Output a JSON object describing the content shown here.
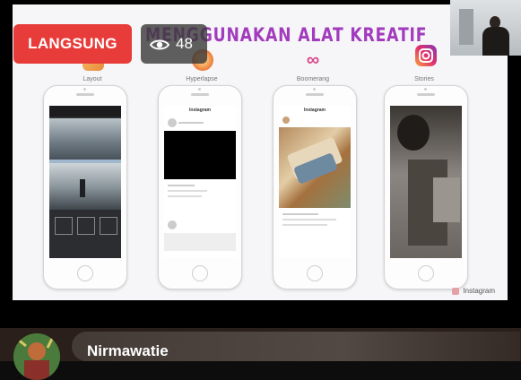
{
  "badges": {
    "live_label": "LANGSUNG",
    "viewer_count": "48",
    "viewer_icon": "eye-icon"
  },
  "slide": {
    "title": "MENGGUNAKAN ALAT KREATIF",
    "apps": [
      {
        "label": "Layout",
        "icon": "layout-app-icon",
        "color": "#f0a35e"
      },
      {
        "label": "Hyperlapse",
        "icon": "hyperlapse-app-icon",
        "color": "#f08a4a"
      },
      {
        "label": "Boomerang",
        "icon": "boomerang-app-icon",
        "color": "#d9468a"
      },
      {
        "label": "Stories",
        "icon": "instagram-icon",
        "color": "#c13584"
      }
    ],
    "phone_header": "Instagram",
    "footer_mark": "Instagram"
  },
  "comment": {
    "user_name": "Nirmawatie"
  },
  "colors": {
    "live_red": "#e83c3a",
    "title_purple": "#a23bbd"
  }
}
